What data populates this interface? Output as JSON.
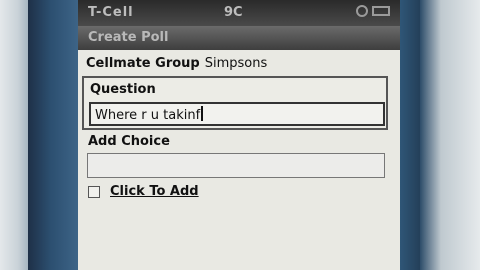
{
  "status_bar": {
    "carrier": "T-Cell",
    "time": "9C",
    "signal_icon": "signal-icon",
    "battery_icon": "battery-icon"
  },
  "title_bar": {
    "title": "Create Poll"
  },
  "group": {
    "label": "Cellmate Group",
    "value": "Simpsons"
  },
  "question": {
    "label": "Question",
    "value": "Where r u takinf"
  },
  "choice": {
    "label": "Add Choice",
    "value": ""
  },
  "add": {
    "label": "Click To Add"
  }
}
